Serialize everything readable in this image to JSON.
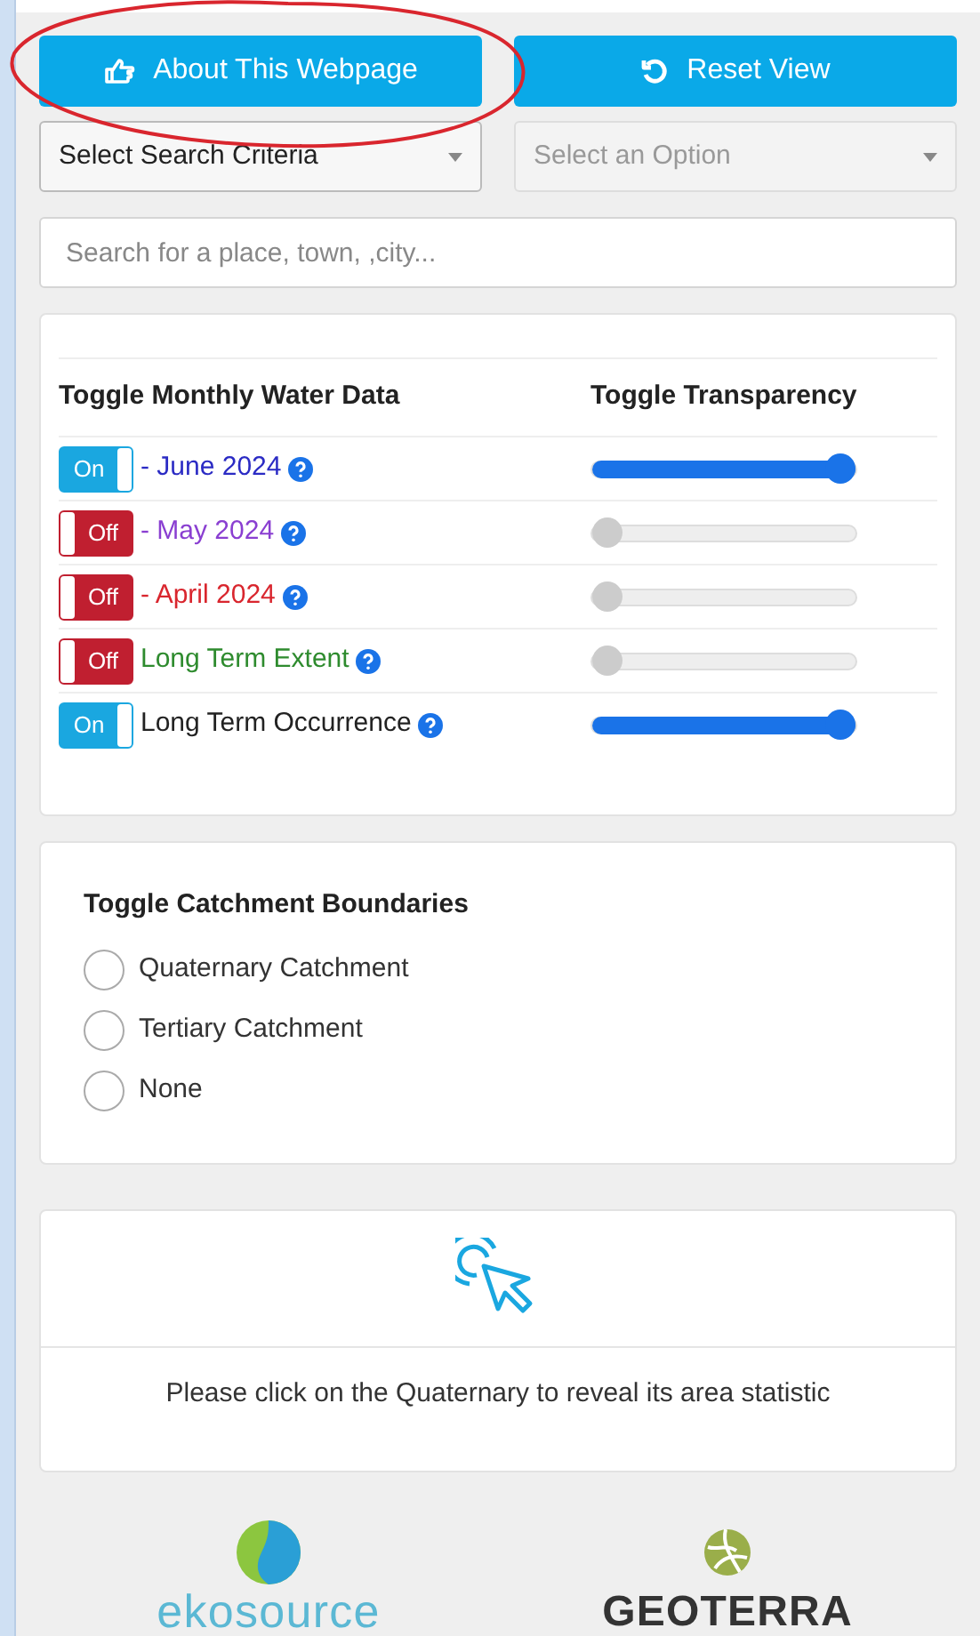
{
  "buttons": [
    {
      "label": "About This Webpage",
      "kind": "about"
    },
    {
      "label": "Reset View",
      "kind": "reset"
    }
  ],
  "selects": [
    {
      "value": "Select Search Criteria",
      "disabled": false
    },
    {
      "value": "Select an Option",
      "disabled": true
    }
  ],
  "search": {
    "placeholder": "Search for a place, town, ,city..."
  },
  "water_data": {
    "headers": [
      "Toggle Monthly Water Data",
      "Toggle Transparency"
    ],
    "layers": [
      {
        "toggle": "On",
        "on": true,
        "label": "- June 2024",
        "color": "#2b2bc4",
        "level": 1
      },
      {
        "toggle": "Off",
        "on": false,
        "label": "- May 2024",
        "color": "#8a3fd1",
        "level": 0
      },
      {
        "toggle": "Off",
        "on": false,
        "label": "- April 2024",
        "color": "#d9262e",
        "level": 0
      },
      {
        "toggle": "Off",
        "on": false,
        "label": "Long Term Extent",
        "color": "#2e8b2e",
        "level": 0
      },
      {
        "toggle": "On",
        "on": true,
        "label": "Long Term Occurrence",
        "color": "#222222",
        "level": 1
      }
    ]
  },
  "catchments": {
    "title": "Toggle Catchment Boundaries",
    "options": [
      {
        "label": "Quaternary Catchment",
        "selected": false
      },
      {
        "label": "Tertiary Catchment",
        "selected": false
      },
      {
        "label": "None",
        "selected": false
      }
    ]
  },
  "statistics": {
    "message": "Please click on the Quaternary to reveal its area statistic"
  },
  "logos": [
    {
      "text": "ekosource",
      "kind": "eko"
    },
    {
      "text": "GEOTERRA",
      "kind": "geo"
    }
  ]
}
